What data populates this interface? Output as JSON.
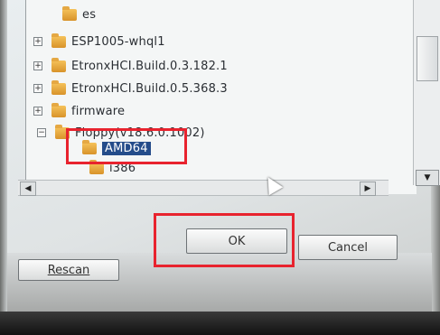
{
  "tree": {
    "rows": [
      {
        "label": "es",
        "expander": ""
      },
      {
        "label": "ESP1005-whql1",
        "expander": "+"
      },
      {
        "label": "EtronxHCI.Build.0.3.182.1",
        "expander": "+"
      },
      {
        "label": "EtronxHCI.Build.0.5.368.3",
        "expander": "+"
      },
      {
        "label": "firmware",
        "expander": "+"
      },
      {
        "label": "Floppy(v18.6.0.1002)",
        "expander": "−"
      },
      {
        "label": "AMD64",
        "expander": ""
      },
      {
        "label": "i386",
        "expander": ""
      }
    ]
  },
  "buttons": {
    "ok_label": "OK",
    "cancel_label": "Cancel",
    "rescan_label": "Rescan"
  },
  "colors": {
    "selection": "#244c8a",
    "highlight_box": "#e8232e"
  }
}
